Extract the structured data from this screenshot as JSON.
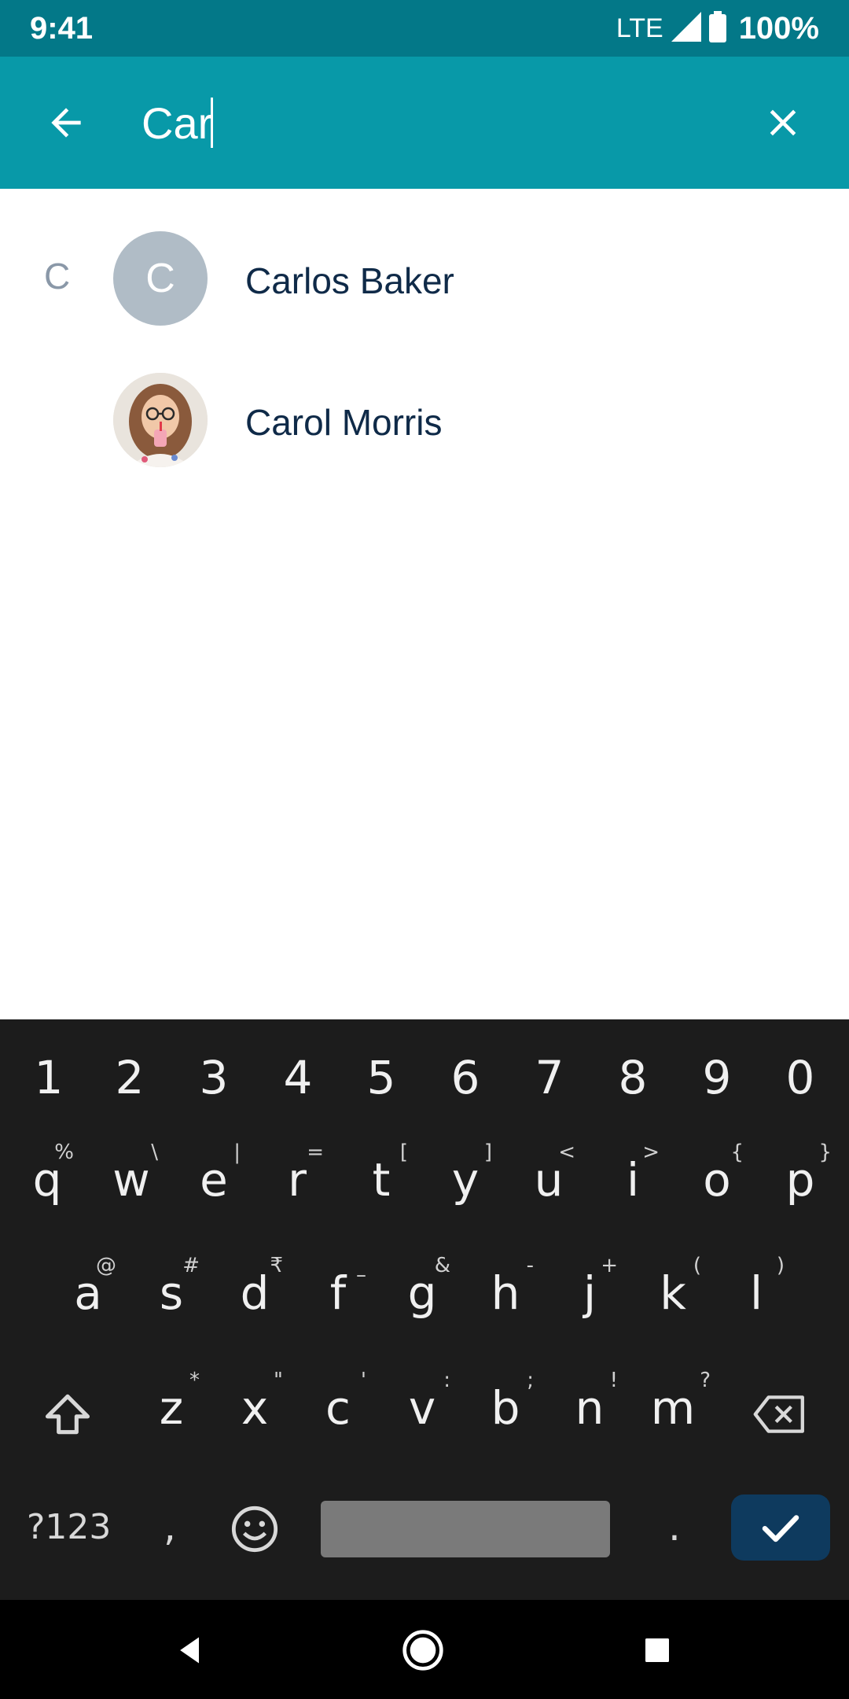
{
  "status_bar": {
    "time": "9:41",
    "network": "LTE",
    "battery": "100%"
  },
  "search": {
    "value": "Car",
    "placeholder": ""
  },
  "contacts": {
    "section_letter": "C",
    "items": [
      {
        "name": "Carlos Baker",
        "avatar_letter": "C"
      },
      {
        "name": "Carol Morris",
        "avatar_letter": ""
      }
    ]
  },
  "keyboard": {
    "number_row": [
      "1",
      "2",
      "3",
      "4",
      "5",
      "6",
      "7",
      "8",
      "9",
      "0"
    ],
    "row1": [
      {
        "k": "q",
        "h": "%"
      },
      {
        "k": "w",
        "h": "\\"
      },
      {
        "k": "e",
        "h": "|"
      },
      {
        "k": "r",
        "h": "="
      },
      {
        "k": "t",
        "h": "["
      },
      {
        "k": "y",
        "h": "]"
      },
      {
        "k": "u",
        "h": "<"
      },
      {
        "k": "i",
        "h": ">"
      },
      {
        "k": "o",
        "h": "{"
      },
      {
        "k": "p",
        "h": "}"
      }
    ],
    "row2": [
      {
        "k": "a",
        "h": "@"
      },
      {
        "k": "s",
        "h": "#"
      },
      {
        "k": "d",
        "h": "₹"
      },
      {
        "k": "f",
        "h": "–"
      },
      {
        "k": "g",
        "h": "&"
      },
      {
        "k": "h",
        "h": "-"
      },
      {
        "k": "j",
        "h": "+"
      },
      {
        "k": "k",
        "h": "("
      },
      {
        "k": "l",
        "h": ")"
      }
    ],
    "row3": [
      {
        "k": "z",
        "h": "*"
      },
      {
        "k": "x",
        "h": "\""
      },
      {
        "k": "c",
        "h": "'"
      },
      {
        "k": "v",
        "h": ":"
      },
      {
        "k": "b",
        "h": ";"
      },
      {
        "k": "n",
        "h": "!"
      },
      {
        "k": "m",
        "h": "?"
      }
    ],
    "symbols_label": "?123",
    "comma": ",",
    "period": "."
  },
  "colors": {
    "status_bar": "#037888",
    "app_bar": "#0899A8",
    "keyboard_bg": "#1C1C1C",
    "enter_key": "#0E3A5E",
    "contact_name": "#0F2A48",
    "avatar_placeholder": "#B0BCC6"
  },
  "icons": {
    "back": "arrow-left-icon",
    "clear": "close-icon",
    "shift": "shift-icon",
    "backspace": "backspace-icon",
    "emoji": "emoji-icon",
    "enter": "check-icon",
    "nav_back": "triangle-back-icon",
    "nav_home": "circle-home-icon",
    "nav_recents": "square-recents-icon"
  }
}
